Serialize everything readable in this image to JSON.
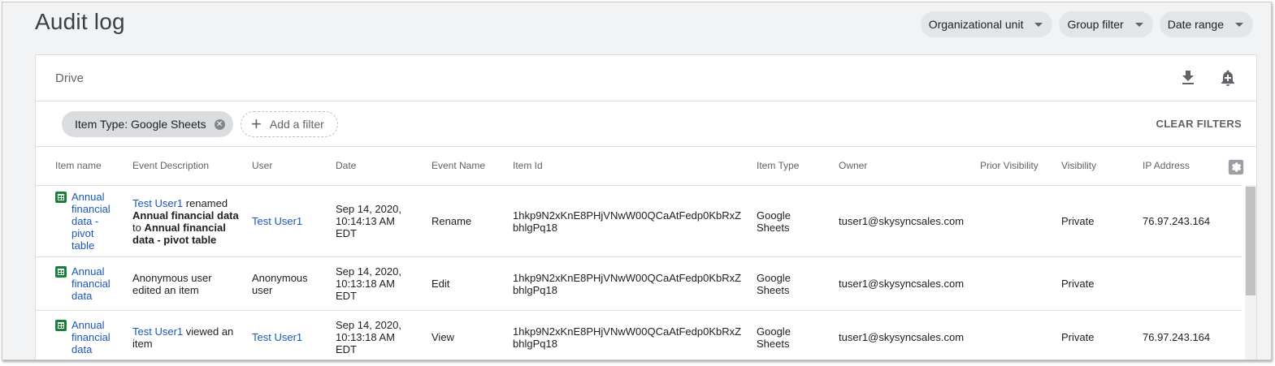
{
  "page": {
    "title": "Audit log"
  },
  "top_filters": [
    {
      "label": "Organizational unit"
    },
    {
      "label": "Group filter"
    },
    {
      "label": "Date range"
    }
  ],
  "card": {
    "title": "Drive",
    "download_icon": "download-icon",
    "alert_icon": "add-alert-icon"
  },
  "chips": {
    "active_filter": "Item Type: Google Sheets",
    "add_filter": "Add a filter",
    "clear_filters": "CLEAR FILTERS"
  },
  "table": {
    "columns": [
      "Item name",
      "Event Description",
      "User",
      "Date",
      "Event Name",
      "Item Id",
      "Item Type",
      "Owner",
      "Prior Visibility",
      "Visibility",
      "IP Address"
    ],
    "rows": [
      {
        "item_name": "Annual financial data - pivot table",
        "desc": {
          "actor": "Test User1",
          "verb": " renamed ",
          "from": "Annual financial data",
          "mid": " to ",
          "to": "Annual financial data - pivot table"
        },
        "user": "Test User1",
        "date": "Sep 14, 2020, 10:14:13 AM EDT",
        "event_name": "Rename",
        "item_id": "1hkp9N2xKnE8PHjVNwW00QCaAtFedp0KbRxZbhlgPq18",
        "item_type": "Google Sheets",
        "owner": "tuser1@skysyncsales.com",
        "prior_visibility": "",
        "visibility": "Private",
        "ip": "76.97.243.164"
      },
      {
        "item_name": "Annual financial data",
        "desc": {
          "text": "Anonymous user edited an item"
        },
        "user": "Anonymous user",
        "date": "Sep 14, 2020, 10:13:18 AM EDT",
        "event_name": "Edit",
        "item_id": "1hkp9N2xKnE8PHjVNwW00QCaAtFedp0KbRxZbhlgPq18",
        "item_type": "Google Sheets",
        "owner": "tuser1@skysyncsales.com",
        "prior_visibility": "",
        "visibility": "Private",
        "ip": ""
      },
      {
        "item_name": "Annual financial data",
        "desc": {
          "actor": "Test User1",
          "rest": " viewed an item"
        },
        "user": "Test User1",
        "date": "Sep 14, 2020, 10:13:18 AM EDT",
        "event_name": "View",
        "item_id": "1hkp9N2xKnE8PHjVNwW00QCaAtFedp0KbRxZbhlgPq18",
        "item_type": "Google Sheets",
        "owner": "tuser1@skysyncsales.com",
        "prior_visibility": "",
        "visibility": "Private",
        "ip": "76.97.243.164"
      }
    ]
  },
  "colors": {
    "link": "#1a57b8",
    "sheets_green": "#188038",
    "page_bg": "#f1f3f4"
  }
}
